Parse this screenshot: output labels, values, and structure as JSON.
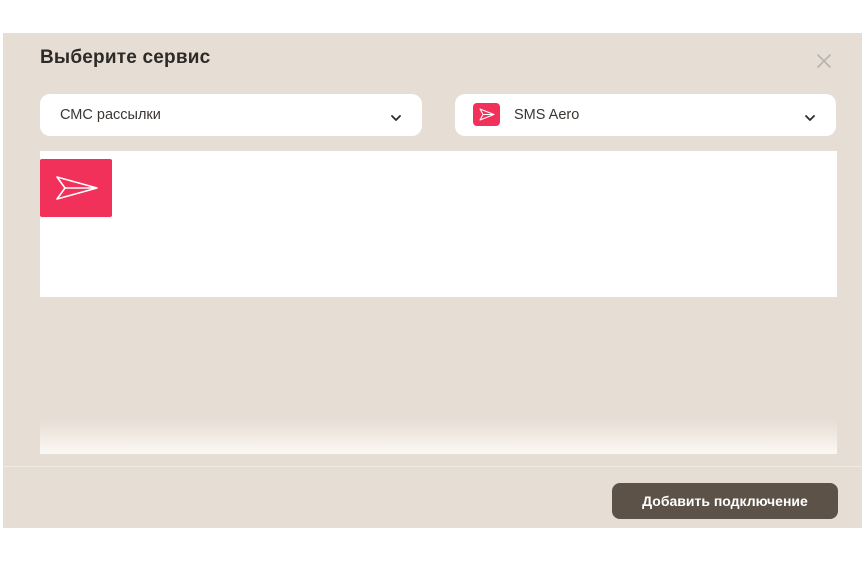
{
  "dialog": {
    "title": "Выберите сервис",
    "close_icon": "close-icon"
  },
  "category_select": {
    "value": "СМС рассылки",
    "icon": "chevron-down-icon"
  },
  "service_select": {
    "value": "SMS Aero",
    "icon": "paper-plane-icon"
  },
  "service_list": [
    {
      "icon": "paper-plane-icon",
      "color": "#f2315a"
    }
  ],
  "footer": {
    "add_button_label": "Добавить подключение"
  },
  "colors": {
    "background": "#e6ddd4",
    "accent": "#f2315a",
    "button": "#5c5248"
  }
}
